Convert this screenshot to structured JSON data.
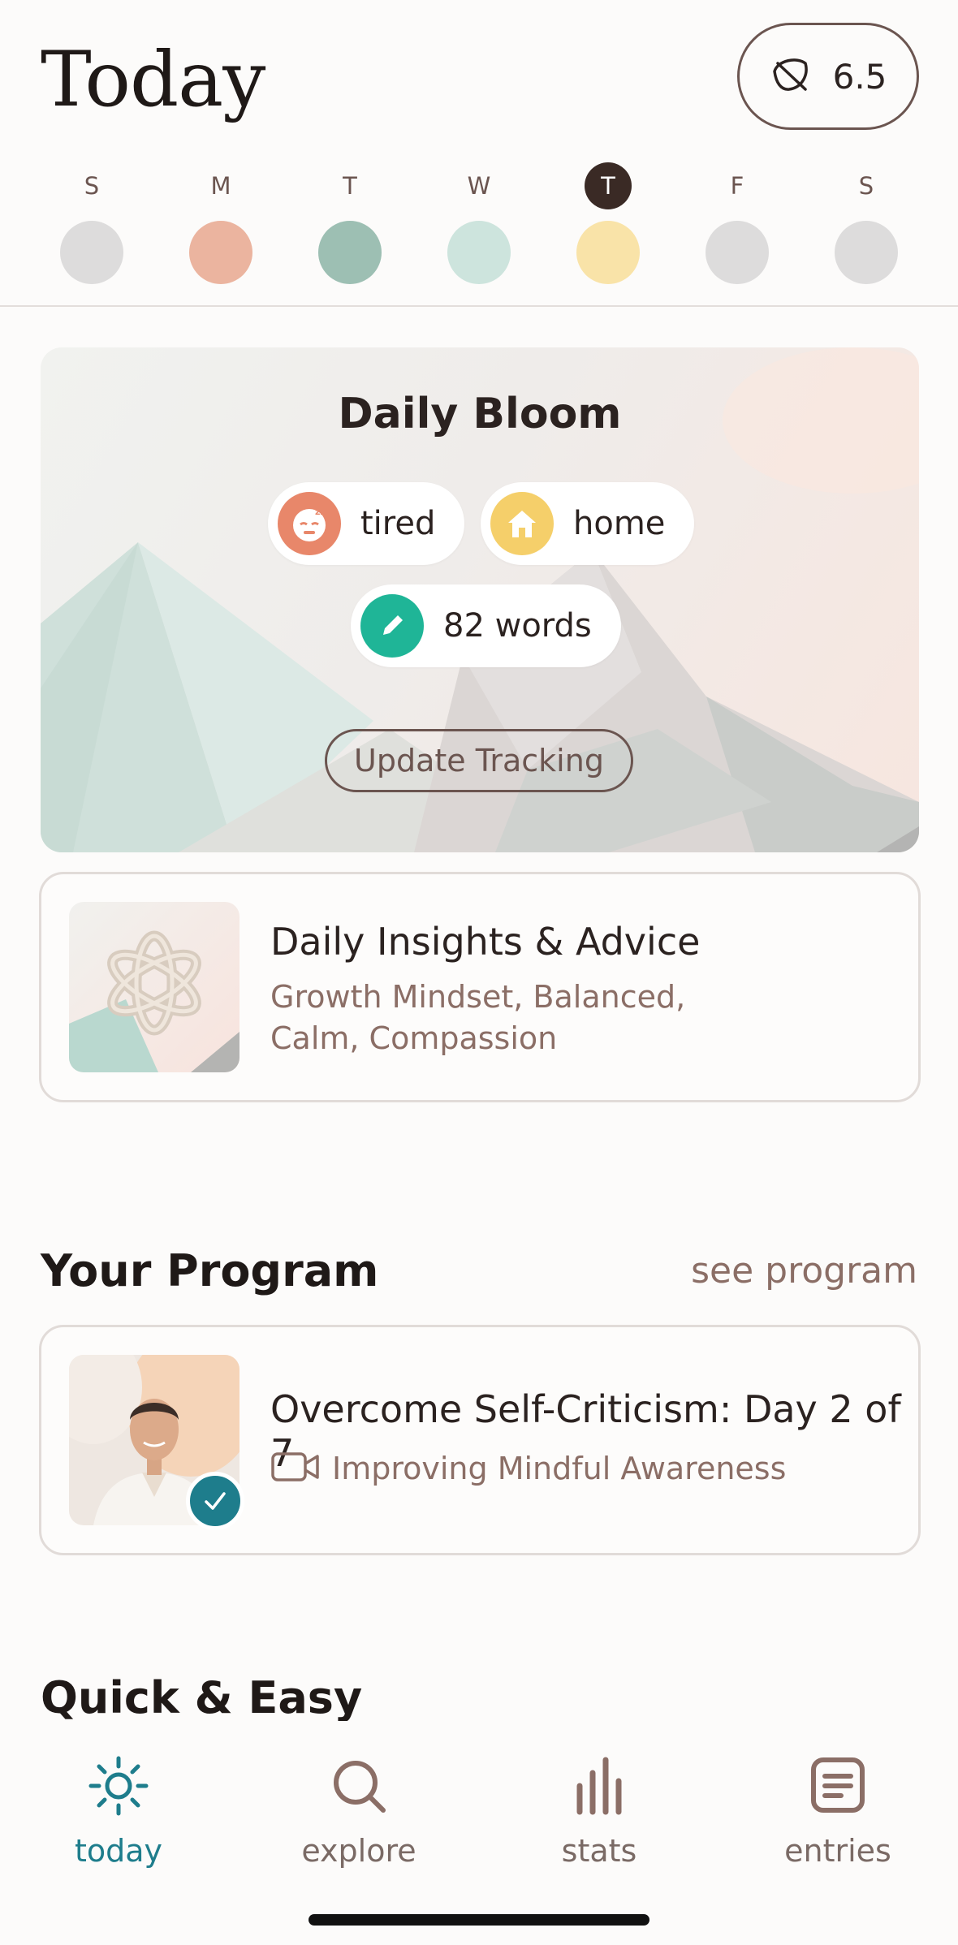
{
  "header": {
    "title": "Today",
    "score": "6.5"
  },
  "week": [
    {
      "letter": "S",
      "color": "#dddcdc",
      "active": false
    },
    {
      "letter": "M",
      "color": "#ebb49f",
      "active": false
    },
    {
      "letter": "T",
      "color": "#9dbfb3",
      "active": false
    },
    {
      "letter": "W",
      "color": "#cde4dd",
      "active": false
    },
    {
      "letter": "T",
      "color": "#f9e3a8",
      "active": true
    },
    {
      "letter": "F",
      "color": "#dddcdc",
      "active": false
    },
    {
      "letter": "S",
      "color": "#dddcdc",
      "active": false
    }
  ],
  "bloom": {
    "title": "Daily Bloom",
    "chips": {
      "mood": "tired",
      "place": "home",
      "words": "82 words"
    },
    "update_label": "Update Tracking"
  },
  "insights": {
    "title": "Daily Insights & Advice",
    "subtitle_line1": "Growth Mindset, Balanced,",
    "subtitle_line2": "Calm, Compassion"
  },
  "program": {
    "section_title": "Your Program",
    "see_label": "see program",
    "title": "Overcome Self-Criticism: Day 2 of 7",
    "subtitle": "Improving Mindful Awareness"
  },
  "quick": {
    "section_title": "Quick & Easy"
  },
  "nav": [
    {
      "label": "today",
      "icon": "sun-icon",
      "active": true
    },
    {
      "label": "explore",
      "icon": "search-icon",
      "active": false
    },
    {
      "label": "stats",
      "icon": "bar-chart-icon",
      "active": false
    },
    {
      "label": "entries",
      "icon": "journal-icon",
      "active": false
    }
  ],
  "colors": {
    "accent": "#1e7d8c",
    "brown": "#6b5550",
    "mood_orange": "#e8876a",
    "home_yellow": "#f5cf6a",
    "words_teal": "#1fb597"
  }
}
